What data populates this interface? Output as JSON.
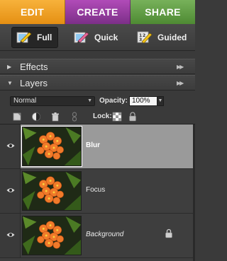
{
  "tabs": [
    {
      "label": "EDIT"
    },
    {
      "label": "CREATE"
    },
    {
      "label": "SHARE"
    }
  ],
  "modes": [
    {
      "label": "Full",
      "icon": "full-edit-icon"
    },
    {
      "label": "Quick",
      "icon": "quick-edit-icon"
    },
    {
      "label": "Guided",
      "icon": "guided-edit-icon"
    }
  ],
  "panels": {
    "effects": {
      "title": "Effects"
    },
    "layers": {
      "title": "Layers"
    }
  },
  "layer_controls": {
    "blend_mode": "Normal",
    "opacity_label": "Opacity:",
    "opacity_value": "100%",
    "lock_label": "Lock:"
  },
  "layers": [
    {
      "name": "Blur",
      "selected": true
    },
    {
      "name": "Focus",
      "selected": false
    },
    {
      "name": "Background",
      "selected": false,
      "locked": true
    }
  ],
  "colors": {
    "edit_tab": "#e58f13",
    "create_tab": "#7c2f88",
    "share_tab": "#4e8a33",
    "selected_layer": "#9a9a9a",
    "panel_bg": "#3a3a3a"
  }
}
